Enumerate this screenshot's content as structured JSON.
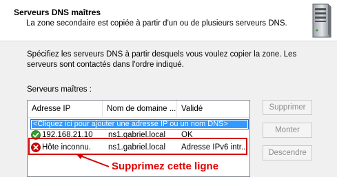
{
  "header": {
    "title": "Serveurs DNS maîtres",
    "subtitle": "La zone secondaire est copiée à partir d'un ou de plusieurs serveurs DNS."
  },
  "instructions": "Spécifiez les serveurs DNS à partir desquels vous voulez copier la zone. Les serveurs sont contactés dans l'ordre indiqué.",
  "masters_label": "Serveurs maîtres :",
  "table": {
    "columns": [
      "Adresse IP",
      "Nom de domaine ...",
      "Validé"
    ],
    "add_row_text": "<Cliquez ici pour ajouter une adresse IP ou un nom DNS>",
    "rows": [
      {
        "ip": "192.168.21.10",
        "domain": "ns1.gabriel.local",
        "status": "OK",
        "icon": "check-icon"
      },
      {
        "ip": "Hôte inconnu.",
        "domain": "ns1.gabriel.local",
        "status": "Adresse IPv6 intr...",
        "icon": "error-icon"
      }
    ]
  },
  "buttons": {
    "delete": "Supprimer",
    "up": "Monter",
    "down": "Descendre"
  },
  "annotation": {
    "text": "Supprimez cette ligne",
    "color": "#e00000"
  },
  "colors": {
    "selection": "#3399ff",
    "ok_green": "#2e9e2e",
    "error_red": "#d40000"
  }
}
